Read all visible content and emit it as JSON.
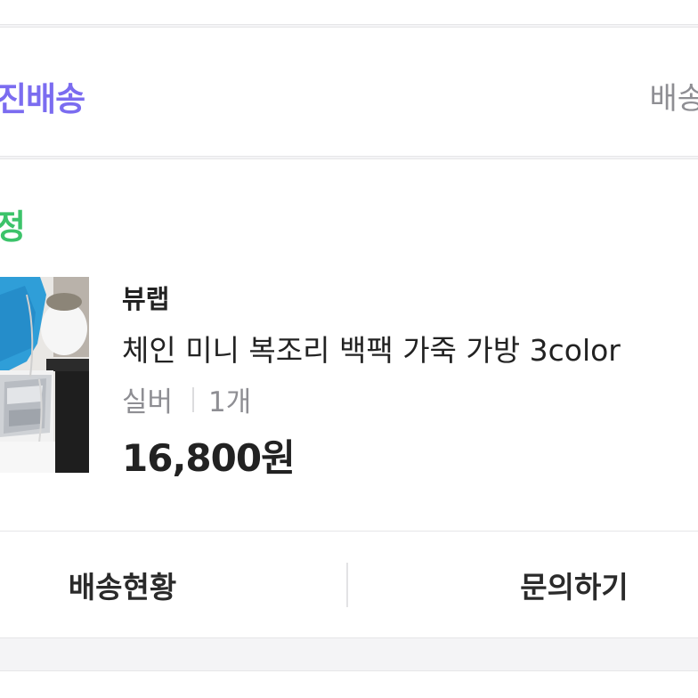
{
  "delivery": {
    "type_label": "진배송",
    "link_label": "배송"
  },
  "order": {
    "status": "정",
    "seller": "뷰랩",
    "product_name": "체인 미니 복조리 백팩 가죽 가방 3color",
    "option": "실버",
    "quantity": "1개",
    "price": "16,800원"
  },
  "actions": {
    "delivery_status": "배송현황",
    "inquiry": "문의하기"
  },
  "colors": {
    "accent": "#7b6cf0",
    "status_green": "#3cc36a",
    "muted_text": "#8e8e93",
    "primary_text": "#222222",
    "background": "#f4f4f6"
  },
  "icons": {
    "thumbnail": "product-photo-silver-chain-bag"
  }
}
